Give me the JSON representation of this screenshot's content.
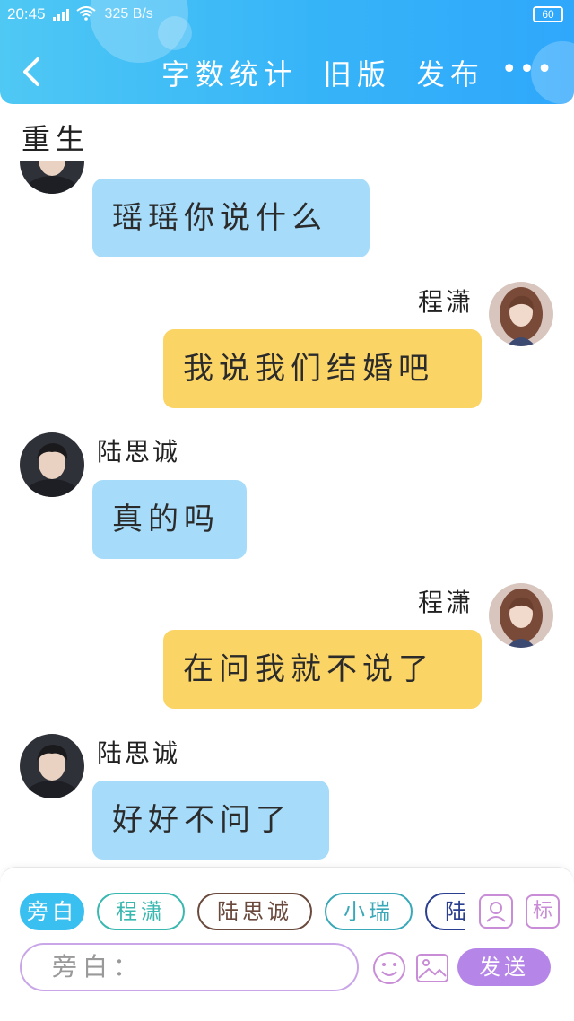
{
  "status_bar": {
    "time": "20:45",
    "network_speed": "325 B/s",
    "battery": "60"
  },
  "header": {
    "actions": [
      "字数统计",
      "旧版",
      "发布"
    ],
    "colors": {
      "gradient_start": "#4fc8f4",
      "gradient_end": "#2fa7fb"
    }
  },
  "scene_label": "重生",
  "messages": [
    {
      "side": "left",
      "speaker": "",
      "text": "瑶瑶你说什么"
    },
    {
      "side": "right",
      "speaker": "程潇",
      "text": "我说我们结婚吧"
    },
    {
      "side": "left",
      "speaker": "陆思诚",
      "text": "真的吗"
    },
    {
      "side": "right",
      "speaker": "程潇",
      "text": "在问我就不说了"
    },
    {
      "side": "left",
      "speaker": "陆思诚",
      "text": "好好不问了"
    }
  ],
  "composer": {
    "roles": [
      {
        "label": "旁白",
        "color": "#39bff0",
        "active": true
      },
      {
        "label": "程潇",
        "color": "#3ab8b0",
        "active": false
      },
      {
        "label": "陆思诚",
        "color": "#6b4a3e",
        "active": false
      },
      {
        "label": "小瑞",
        "color": "#3aa8b8",
        "active": false
      },
      {
        "label": "陆",
        "color": "#2a3f8f",
        "active": false
      }
    ],
    "placeholder": "旁白：",
    "tag_label": "标",
    "send_label": "发送",
    "colors": {
      "accent": "#b586e8",
      "left_bubble": "#a6dcfa",
      "right_bubble": "#fbd466"
    }
  },
  "icons": [
    "back-arrow-icon",
    "more-icon",
    "contact-icon",
    "emoji-icon",
    "image-icon"
  ]
}
